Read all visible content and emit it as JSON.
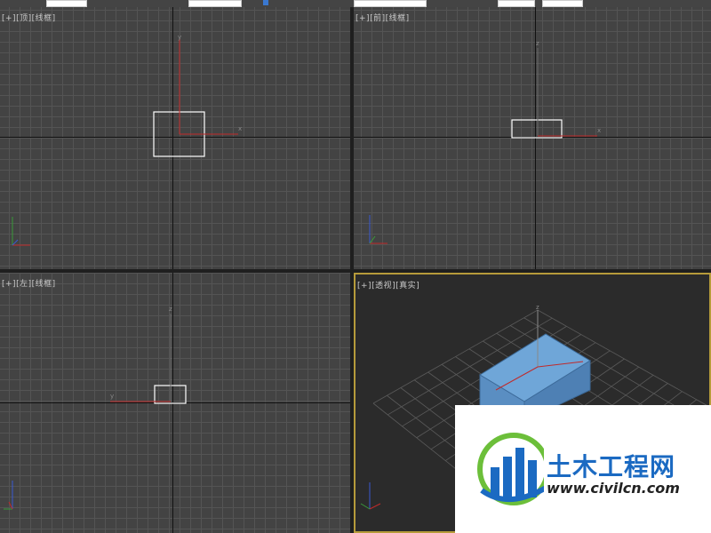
{
  "viewports": {
    "top": {
      "plus": "[+]",
      "view": "[顶]",
      "mode": "[线框]",
      "axis_x": "x",
      "axis_y": "y"
    },
    "front": {
      "plus": "[+]",
      "view": "[前]",
      "mode": "[线框]",
      "axis_x": "x",
      "axis_z": "z"
    },
    "left": {
      "plus": "[+]",
      "view": "[左]",
      "mode": "[线框]",
      "axis_y": "y",
      "axis_z": "z"
    },
    "persp": {
      "plus": "[+]",
      "view": "[透视]",
      "mode": "[真实]",
      "axis_z": "z"
    }
  },
  "colors": {
    "box_fill": "#5f95c8",
    "box_top": "#6fa6d8",
    "selection": "#ffffff",
    "axis_red": "#c02a2a",
    "active_border": "#b69b3a",
    "watermark_blue": "#1b6ac2",
    "watermark_green": "#6cbf3a"
  },
  "watermark": {
    "title": "土木工程网",
    "url": "www.civilcn.com",
    "logo_icon": "civilcn-logo-icon"
  }
}
